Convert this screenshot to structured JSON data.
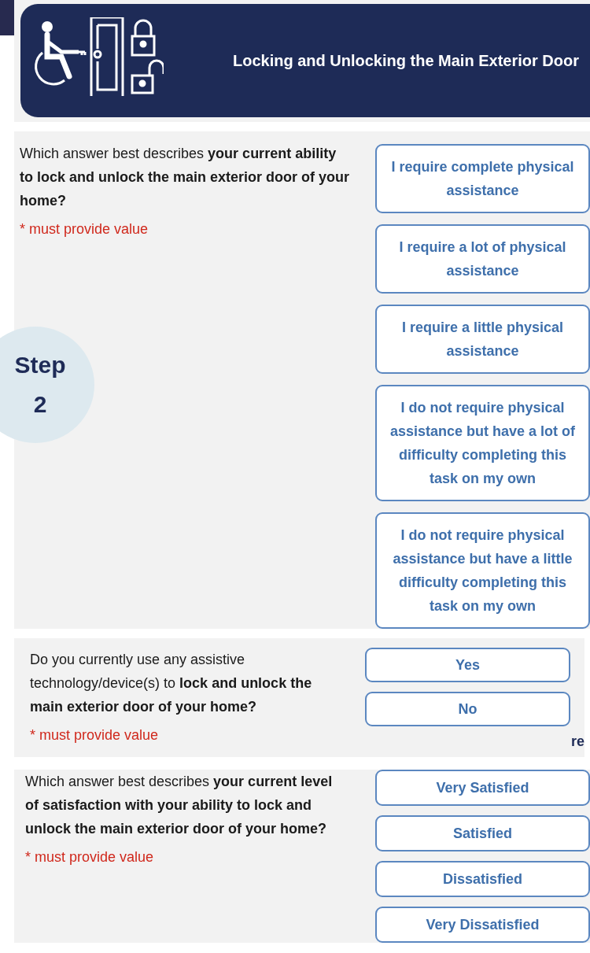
{
  "header": {
    "title": "Locking and Unlocking the Main Exterior Door"
  },
  "step": {
    "label": "Step",
    "number": "2"
  },
  "questions": [
    {
      "text": "Which answer best describes **your current ability to lock and unlock the main exterior door of your home?**",
      "note": "* must provide value",
      "options": [
        {
          "label": "I require complete physical assistance",
          "selected": false
        },
        {
          "label": "I require a lot of physical assistance",
          "selected": false
        },
        {
          "label": "I require a little physical assistance",
          "selected": false
        },
        {
          "label": "I do not require physical assistance but have a lot of difficulty completing this task on my own",
          "selected": false
        },
        {
          "label": "I do not require physical assistance but have a little difficulty completing this task on my own",
          "selected": false
        }
      ]
    },
    {
      "text": "Do you currently use any assistive technology/device(s) to **lock and unlock the main exterior door of your home?**",
      "note": "* must provide value",
      "trailing_text": "re",
      "options": [
        {
          "label": "Yes",
          "selected": false
        },
        {
          "label": "No",
          "selected": false
        }
      ]
    },
    {
      "text": "Which answer best describes **your current level of satisfaction with your ability to lock and unlock the main exterior door of your home?**",
      "note": "* must provide value",
      "options": [
        {
          "label": "Very Satisfied",
          "selected": false
        },
        {
          "label": "Satisfied",
          "selected": false
        },
        {
          "label": "Dissatisfied",
          "selected": false
        },
        {
          "label": "Very Dissatisfied",
          "selected": false
        }
      ]
    }
  ]
}
